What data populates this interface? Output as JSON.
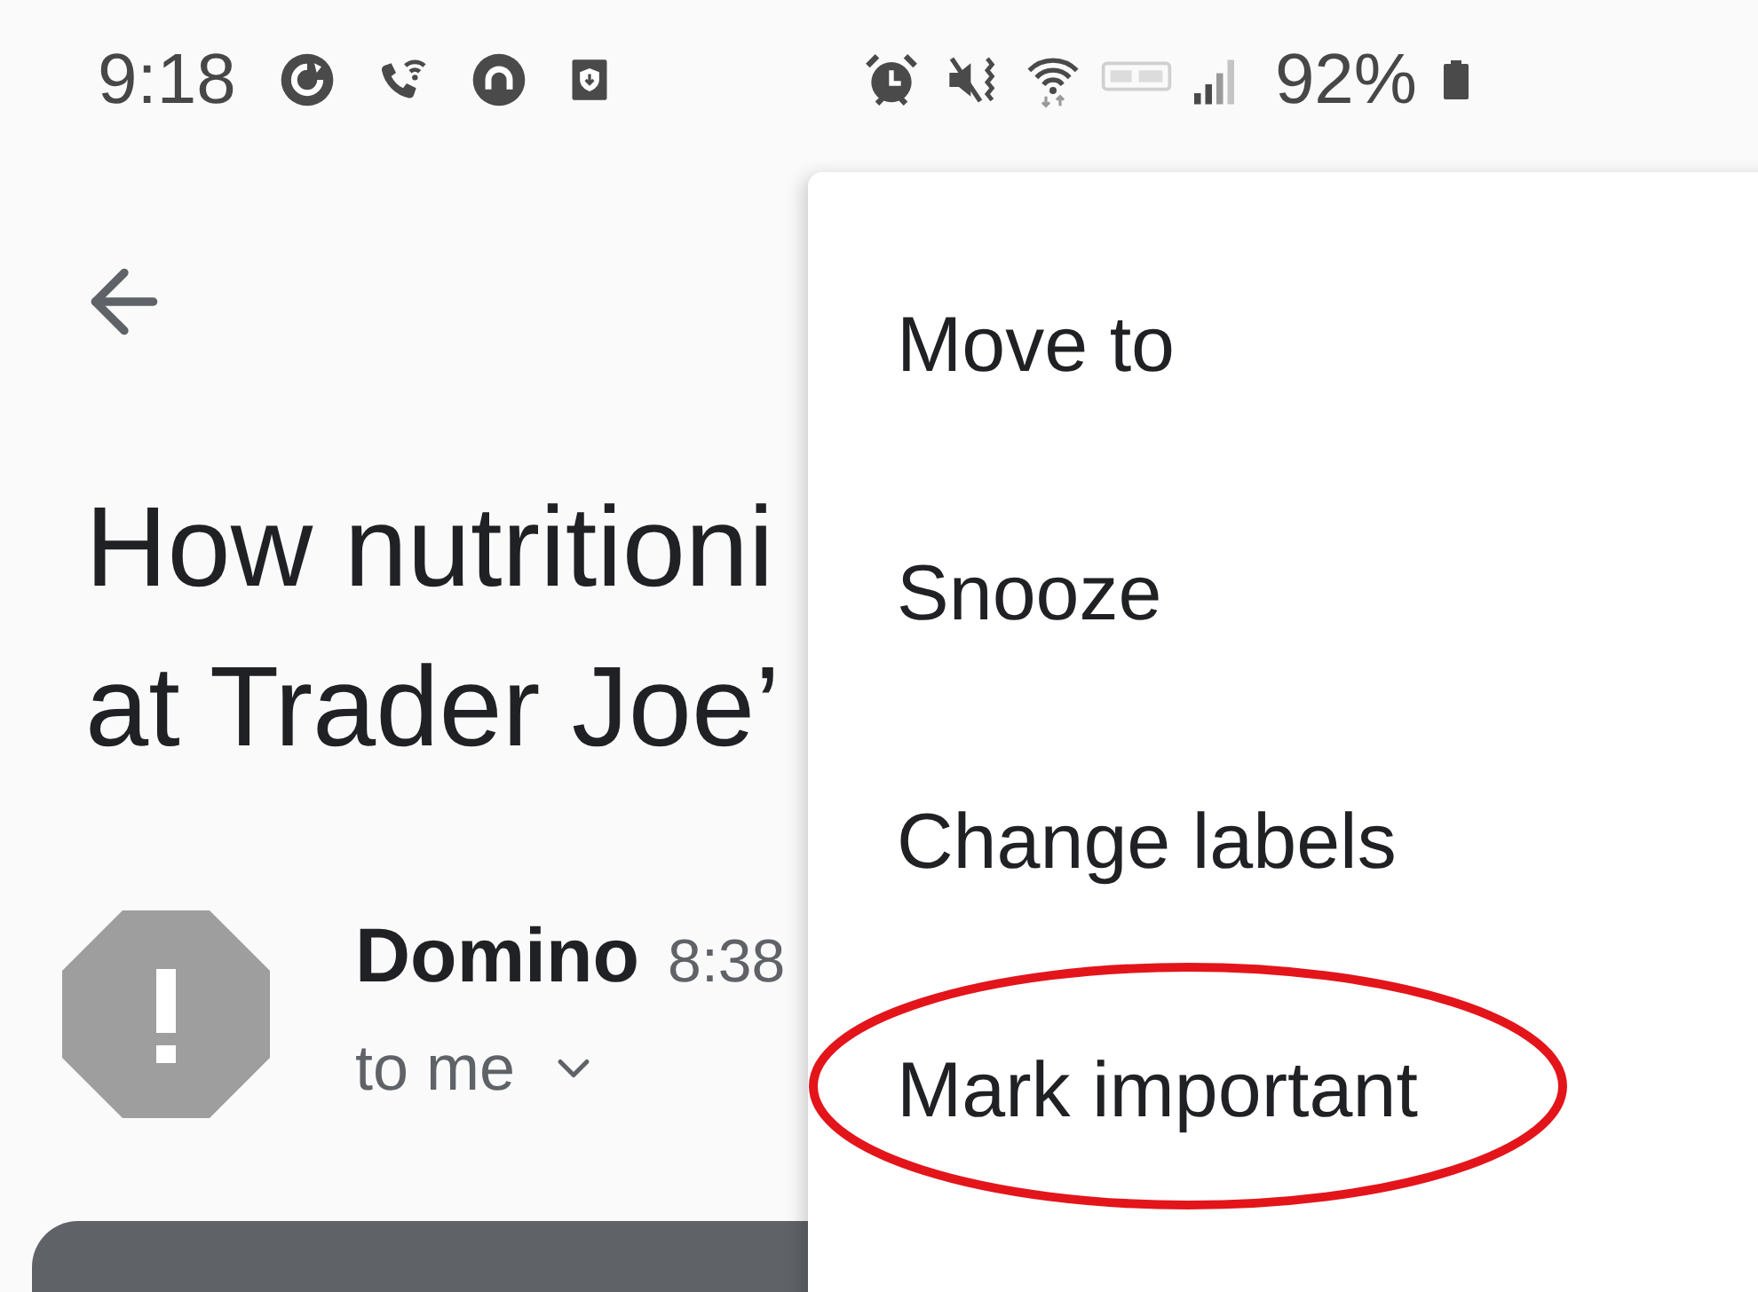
{
  "status_bar": {
    "time": "9:18",
    "battery": "92%"
  },
  "email": {
    "subject_lines": [
      "How nutritioni",
      "at Trader Joe’"
    ],
    "sender": "Domino",
    "time": "8:38",
    "recipient": "to me"
  },
  "menu": {
    "items": [
      {
        "label": "Move to",
        "circled": false
      },
      {
        "label": "Snooze",
        "circled": false
      },
      {
        "label": "Change labels",
        "circled": false
      },
      {
        "label": "Mark important",
        "circled": true
      }
    ]
  }
}
